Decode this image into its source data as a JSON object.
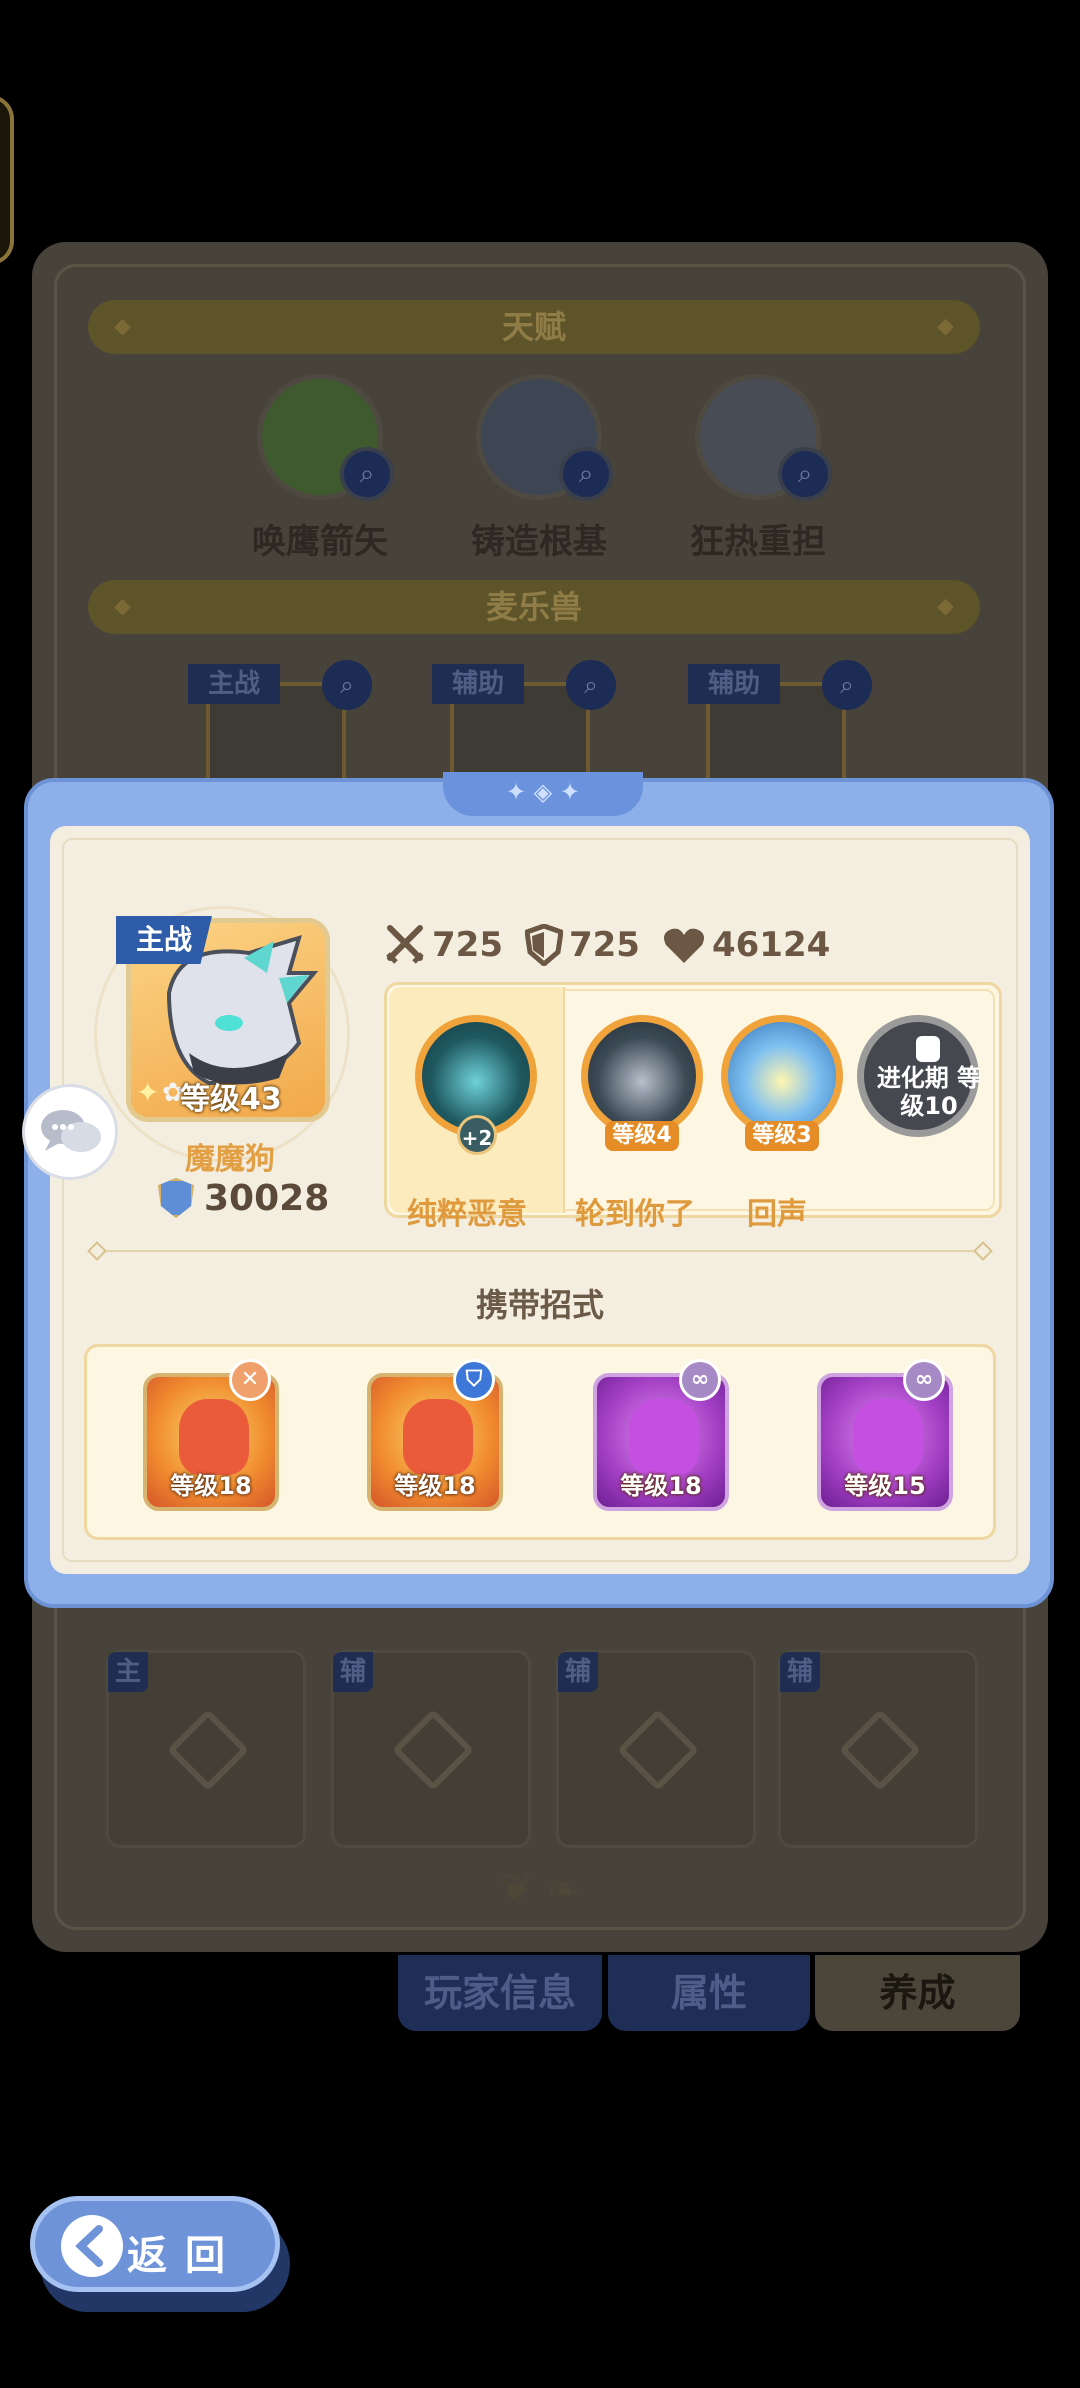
{
  "background": {
    "talent_header": "天赋",
    "talents": [
      {
        "name": "唤鹰箭矢",
        "icon": "eagle-icon",
        "color": "#3f5a2e"
      },
      {
        "name": "铸造根基",
        "icon": "sword-icon",
        "color": "#3d4652"
      },
      {
        "name": "狂热重担",
        "icon": "eye-icon",
        "color": "#474c55"
      }
    ],
    "pet_header": "麦乐兽",
    "pets": [
      {
        "tag": "主战"
      },
      {
        "tag": "辅助"
      },
      {
        "tag": "辅助"
      }
    ],
    "slots": [
      {
        "tag": "主"
      },
      {
        "tag": "辅"
      },
      {
        "tag": "辅"
      },
      {
        "tag": "辅"
      }
    ]
  },
  "tabs": {
    "player_info": "玩家信息",
    "attributes": "属性",
    "training": "养成"
  },
  "modal": {
    "pet": {
      "tag": "主战",
      "level": "等级43",
      "name": "魔魔狗",
      "power": "30028"
    },
    "stats": {
      "attack": "725",
      "defense": "725",
      "hp": "46124"
    },
    "abilities": [
      {
        "name": "纯粹恶意",
        "badge": "+2",
        "selected": true
      },
      {
        "name": "轮到你了",
        "badge": "等级4"
      },
      {
        "name": "回声",
        "badge": "等级3"
      },
      {
        "name": "",
        "locked_text": "进化期 等级10",
        "locked": true
      }
    ],
    "moves_title": "携带招式",
    "moves": [
      {
        "level": "等级18",
        "tag_icon": "sword-cross-icon",
        "tag_color": "#f0a06a",
        "style": "red"
      },
      {
        "level": "等级18",
        "tag_icon": "shield-icon",
        "tag_color": "#3d78d8",
        "style": "red"
      },
      {
        "level": "等级18",
        "tag_icon": "link-icon",
        "tag_color": "#a58ac6",
        "style": "purple"
      },
      {
        "level": "等级15",
        "tag_icon": "link-icon",
        "tag_color": "#a58ac6",
        "style": "purple"
      }
    ]
  },
  "back_button": "返回",
  "colors": {
    "modal_frame": "#8db0ea",
    "parchment": "#f4eee0",
    "accent_orange": "#e29f43"
  }
}
